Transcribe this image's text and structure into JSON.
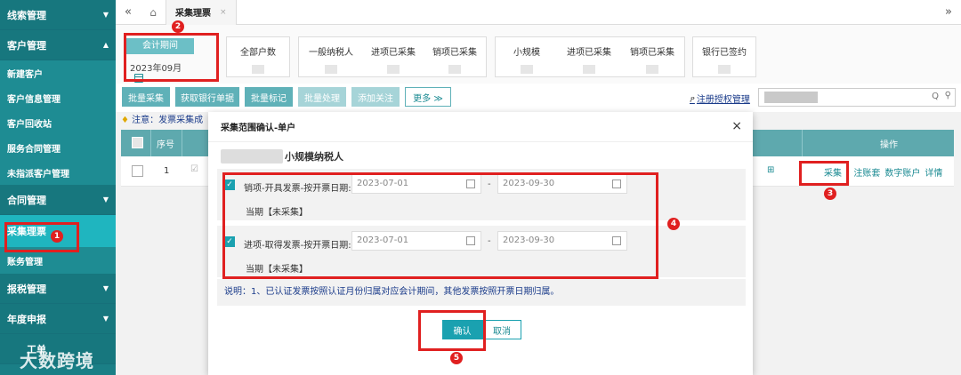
{
  "sidebar": {
    "groups": [
      {
        "label": "线索管理",
        "arrow": "▼"
      },
      {
        "label": "客户管理",
        "arrow": "▲"
      }
    ],
    "customer_items": [
      "新建客户",
      "客户信息管理",
      "客户回收站",
      "服务合同管理",
      "未指派客户管理"
    ],
    "contract": {
      "label": "合同管理",
      "arrow": "▼"
    },
    "active_item": "采集理票",
    "account_item": "账务管理",
    "tax": {
      "label": "报税管理",
      "arrow": "▼"
    },
    "annual": {
      "label": "年度申报",
      "arrow": "▼"
    },
    "bottom_partial": "工单",
    "watermark": "大数跨境"
  },
  "topbar": {
    "collapse_icon": "«",
    "home_icon": "⌂",
    "tab_label": "采集理票",
    "tab_close": "×",
    "expand_icon": "»"
  },
  "stats": {
    "period_label": "会计期间",
    "period_value": "2023年09月",
    "all_label": "全部户数",
    "general_label": "一般纳税人",
    "input_collected": "进项已采集",
    "output_collected": "销项已采集",
    "small_label": "小规模",
    "small_input_collected": "进项已采集",
    "small_output_collected": "销项已采集",
    "bank_signed": "银行已签约"
  },
  "toolbar": {
    "batch_collect": "批量采集",
    "fetch_bank": "获取银行单据",
    "batch_mark": "批量标记",
    "batch_process": "批量处理",
    "add_follow": "添加关注",
    "more": "更多 ≫",
    "register_link": "注册授权管理",
    "person_icon": "ዖ",
    "search_icon": "Q",
    "filter_icon": "⚲"
  },
  "notice": {
    "bulb": "♦",
    "text": "注意：发票采集成"
  },
  "table": {
    "header_no": "序号",
    "header_op": "操作",
    "row": {
      "no": "1",
      "ops": [
        "采集",
        "|",
        "注账套",
        "数字账户",
        "详情"
      ],
      "search_icon": "⊞",
      "edit_icon": "☑"
    }
  },
  "dialog": {
    "title": "采集范围确认-单户",
    "close": "×",
    "subtitle": "小规模纳税人",
    "ranges": [
      {
        "label": "销项-开具发票-按开票日期:",
        "start": "2023-07-01",
        "end": "2023-09-30",
        "state": "当期【未采集】",
        "checked": "✓"
      },
      {
        "label": "进项-取得发票-按开票日期:",
        "start": "2023-07-01",
        "end": "2023-09-30",
        "state": "当期【未采集】",
        "checked": "✓"
      }
    ],
    "dash": "-",
    "note": "说明：1、已认证发票按照认证月份归属对应会计期间，其他发票按照开票日期归属。",
    "confirm": "确认",
    "cancel": "取消"
  },
  "markers": [
    "1",
    "2",
    "3",
    "4",
    "5"
  ]
}
